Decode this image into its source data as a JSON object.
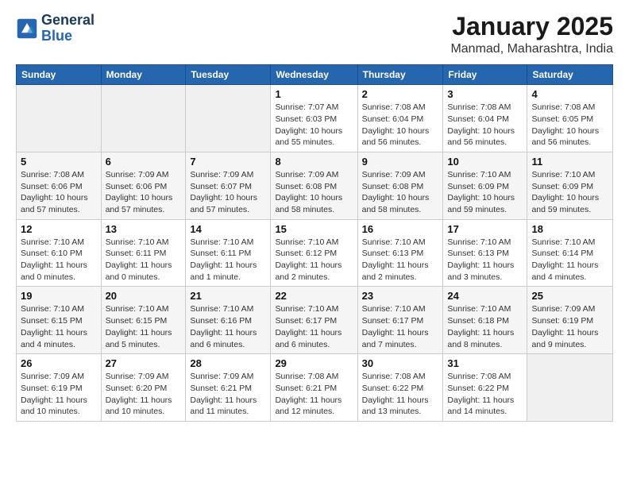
{
  "header": {
    "logo_line1": "General",
    "logo_line2": "Blue",
    "month_title": "January 2025",
    "location": "Manmad, Maharashtra, India"
  },
  "weekdays": [
    "Sunday",
    "Monday",
    "Tuesday",
    "Wednesday",
    "Thursday",
    "Friday",
    "Saturday"
  ],
  "weeks": [
    [
      {
        "day": "",
        "info": ""
      },
      {
        "day": "",
        "info": ""
      },
      {
        "day": "",
        "info": ""
      },
      {
        "day": "1",
        "info": "Sunrise: 7:07 AM\nSunset: 6:03 PM\nDaylight: 10 hours\nand 55 minutes."
      },
      {
        "day": "2",
        "info": "Sunrise: 7:08 AM\nSunset: 6:04 PM\nDaylight: 10 hours\nand 56 minutes."
      },
      {
        "day": "3",
        "info": "Sunrise: 7:08 AM\nSunset: 6:04 PM\nDaylight: 10 hours\nand 56 minutes."
      },
      {
        "day": "4",
        "info": "Sunrise: 7:08 AM\nSunset: 6:05 PM\nDaylight: 10 hours\nand 56 minutes."
      }
    ],
    [
      {
        "day": "5",
        "info": "Sunrise: 7:08 AM\nSunset: 6:06 PM\nDaylight: 10 hours\nand 57 minutes."
      },
      {
        "day": "6",
        "info": "Sunrise: 7:09 AM\nSunset: 6:06 PM\nDaylight: 10 hours\nand 57 minutes."
      },
      {
        "day": "7",
        "info": "Sunrise: 7:09 AM\nSunset: 6:07 PM\nDaylight: 10 hours\nand 57 minutes."
      },
      {
        "day": "8",
        "info": "Sunrise: 7:09 AM\nSunset: 6:08 PM\nDaylight: 10 hours\nand 58 minutes."
      },
      {
        "day": "9",
        "info": "Sunrise: 7:09 AM\nSunset: 6:08 PM\nDaylight: 10 hours\nand 58 minutes."
      },
      {
        "day": "10",
        "info": "Sunrise: 7:10 AM\nSunset: 6:09 PM\nDaylight: 10 hours\nand 59 minutes."
      },
      {
        "day": "11",
        "info": "Sunrise: 7:10 AM\nSunset: 6:09 PM\nDaylight: 10 hours\nand 59 minutes."
      }
    ],
    [
      {
        "day": "12",
        "info": "Sunrise: 7:10 AM\nSunset: 6:10 PM\nDaylight: 11 hours\nand 0 minutes."
      },
      {
        "day": "13",
        "info": "Sunrise: 7:10 AM\nSunset: 6:11 PM\nDaylight: 11 hours\nand 0 minutes."
      },
      {
        "day": "14",
        "info": "Sunrise: 7:10 AM\nSunset: 6:11 PM\nDaylight: 11 hours\nand 1 minute."
      },
      {
        "day": "15",
        "info": "Sunrise: 7:10 AM\nSunset: 6:12 PM\nDaylight: 11 hours\nand 2 minutes."
      },
      {
        "day": "16",
        "info": "Sunrise: 7:10 AM\nSunset: 6:13 PM\nDaylight: 11 hours\nand 2 minutes."
      },
      {
        "day": "17",
        "info": "Sunrise: 7:10 AM\nSunset: 6:13 PM\nDaylight: 11 hours\nand 3 minutes."
      },
      {
        "day": "18",
        "info": "Sunrise: 7:10 AM\nSunset: 6:14 PM\nDaylight: 11 hours\nand 4 minutes."
      }
    ],
    [
      {
        "day": "19",
        "info": "Sunrise: 7:10 AM\nSunset: 6:15 PM\nDaylight: 11 hours\nand 4 minutes."
      },
      {
        "day": "20",
        "info": "Sunrise: 7:10 AM\nSunset: 6:15 PM\nDaylight: 11 hours\nand 5 minutes."
      },
      {
        "day": "21",
        "info": "Sunrise: 7:10 AM\nSunset: 6:16 PM\nDaylight: 11 hours\nand 6 minutes."
      },
      {
        "day": "22",
        "info": "Sunrise: 7:10 AM\nSunset: 6:17 PM\nDaylight: 11 hours\nand 6 minutes."
      },
      {
        "day": "23",
        "info": "Sunrise: 7:10 AM\nSunset: 6:17 PM\nDaylight: 11 hours\nand 7 minutes."
      },
      {
        "day": "24",
        "info": "Sunrise: 7:10 AM\nSunset: 6:18 PM\nDaylight: 11 hours\nand 8 minutes."
      },
      {
        "day": "25",
        "info": "Sunrise: 7:09 AM\nSunset: 6:19 PM\nDaylight: 11 hours\nand 9 minutes."
      }
    ],
    [
      {
        "day": "26",
        "info": "Sunrise: 7:09 AM\nSunset: 6:19 PM\nDaylight: 11 hours\nand 10 minutes."
      },
      {
        "day": "27",
        "info": "Sunrise: 7:09 AM\nSunset: 6:20 PM\nDaylight: 11 hours\nand 10 minutes."
      },
      {
        "day": "28",
        "info": "Sunrise: 7:09 AM\nSunset: 6:21 PM\nDaylight: 11 hours\nand 11 minutes."
      },
      {
        "day": "29",
        "info": "Sunrise: 7:08 AM\nSunset: 6:21 PM\nDaylight: 11 hours\nand 12 minutes."
      },
      {
        "day": "30",
        "info": "Sunrise: 7:08 AM\nSunset: 6:22 PM\nDaylight: 11 hours\nand 13 minutes."
      },
      {
        "day": "31",
        "info": "Sunrise: 7:08 AM\nSunset: 6:22 PM\nDaylight: 11 hours\nand 14 minutes."
      },
      {
        "day": "",
        "info": ""
      }
    ]
  ]
}
